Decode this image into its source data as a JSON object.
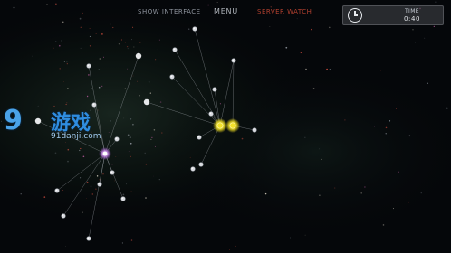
{
  "top_bar": {
    "show_interface": "SHOW INTERFACE",
    "menu": "MENU",
    "alert": "SERVER WATCH"
  },
  "timer": {
    "label": "TIME",
    "value": "0:40",
    "icon": "clock-icon"
  },
  "watermark": {
    "number": "9",
    "title": "游戏",
    "domain": "91danji.com"
  },
  "colors": {
    "background": "#05070a",
    "node": "#d7d9de",
    "node_selected": "#f4e32a",
    "node_purple": "#c98ae8",
    "link": "#aeb3ba",
    "alert": "#b3402f"
  }
}
